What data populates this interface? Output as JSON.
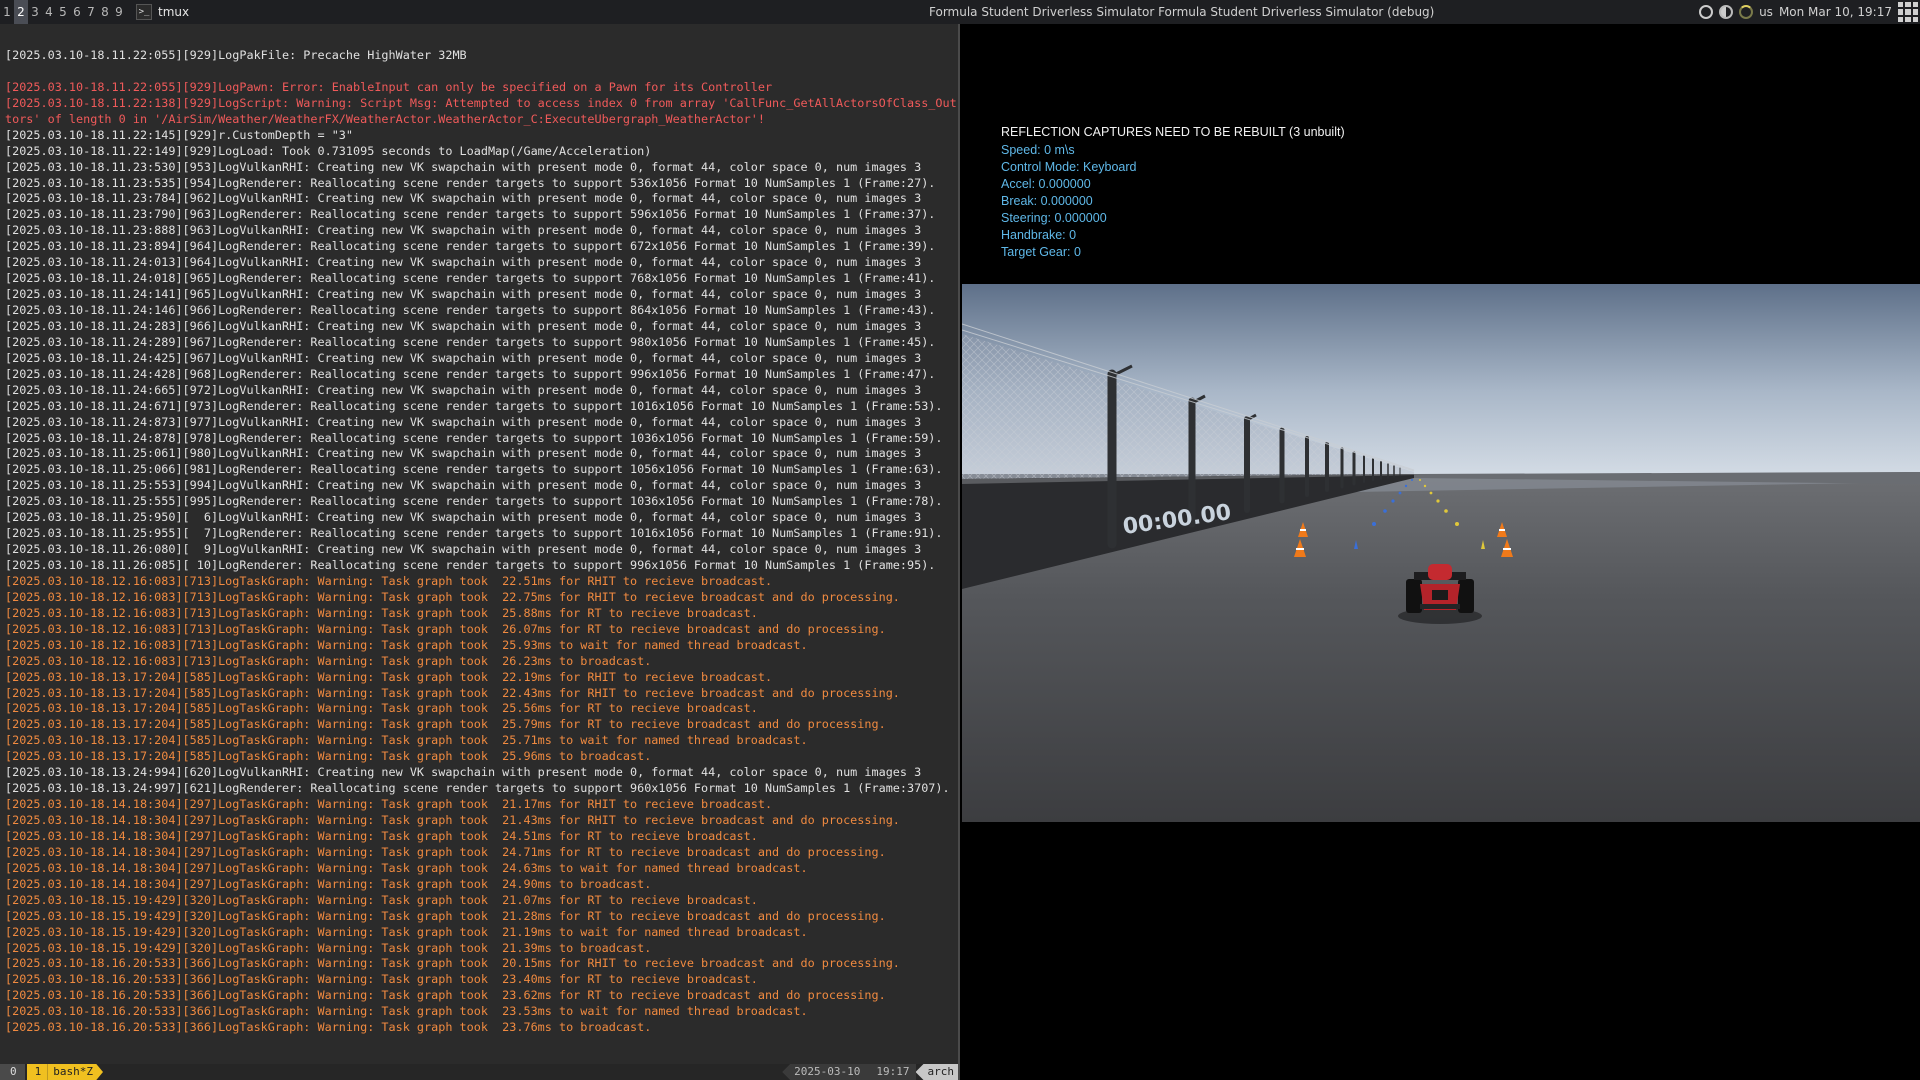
{
  "topbar": {
    "workspaces": [
      "1",
      "2",
      "3",
      "4",
      "5",
      "6",
      "7",
      "8",
      "9"
    ],
    "active_workspace": "2",
    "tmux_icon": ">_",
    "tmux_title": "tmux",
    "focused_title": "Formula Student Driverless Simulator Formula Student Driverless Simulator (debug)",
    "keyboard_layout": "us",
    "clock": "Mon Mar 10, 19:17"
  },
  "terminal": {
    "lines": [
      {
        "t": "[2025.03.10-18.11.22:055][929]LogPakFile: Precache HighWater 32MB",
        "k": "n"
      },
      {
        "t": "",
        "k": "blank"
      },
      {
        "t": "[2025.03.10-18.11.22:055][929]LogPawn: Error: EnableInput can only be specified on a Pawn for its Controller",
        "k": "err"
      },
      {
        "t": "[2025.03.10-18.11.22:138][929]LogScript: Warning: Script Msg: Attempted to access index 0 from array 'CallFunc_GetAllActorsOfClass_OutAc",
        "k": "err"
      },
      {
        "t": "tors' of length 0 in '/AirSim/Weather/WeatherFX/WeatherActor.WeatherActor_C:ExecuteUbergraph_WeatherActor'!",
        "k": "err"
      },
      {
        "t": "[2025.03.10-18.11.22:145][929]r.CustomDepth = \"3\"",
        "k": "n"
      },
      {
        "t": "[2025.03.10-18.11.22:149][929]LogLoad: Took 0.731095 seconds to LoadMap(/Game/Acceleration)",
        "k": "n"
      },
      {
        "t": "[2025.03.10-18.11.23:530][953]LogVulkanRHI: Creating new VK swapchain with present mode 0, format 44, color space 0, num images 3",
        "k": "n"
      },
      {
        "t": "[2025.03.10-18.11.23:535][954]LogRenderer: Reallocating scene render targets to support 536x1056 Format 10 NumSamples 1 (Frame:27).",
        "k": "n"
      },
      {
        "t": "[2025.03.10-18.11.23:784][962]LogVulkanRHI: Creating new VK swapchain with present mode 0, format 44, color space 0, num images 3",
        "k": "n"
      },
      {
        "t": "[2025.03.10-18.11.23:790][963]LogRenderer: Reallocating scene render targets to support 596x1056 Format 10 NumSamples 1 (Frame:37).",
        "k": "n"
      },
      {
        "t": "[2025.03.10-18.11.23:888][963]LogVulkanRHI: Creating new VK swapchain with present mode 0, format 44, color space 0, num images 3",
        "k": "n"
      },
      {
        "t": "[2025.03.10-18.11.23:894][964]LogRenderer: Reallocating scene render targets to support 672x1056 Format 10 NumSamples 1 (Frame:39).",
        "k": "n"
      },
      {
        "t": "[2025.03.10-18.11.24:013][964]LogVulkanRHI: Creating new VK swapchain with present mode 0, format 44, color space 0, num images 3",
        "k": "n"
      },
      {
        "t": "[2025.03.10-18.11.24:018][965]LogRenderer: Reallocating scene render targets to support 768x1056 Format 10 NumSamples 1 (Frame:41).",
        "k": "n"
      },
      {
        "t": "[2025.03.10-18.11.24:141][965]LogVulkanRHI: Creating new VK swapchain with present mode 0, format 44, color space 0, num images 3",
        "k": "n"
      },
      {
        "t": "[2025.03.10-18.11.24:146][966]LogRenderer: Reallocating scene render targets to support 864x1056 Format 10 NumSamples 1 (Frame:43).",
        "k": "n"
      },
      {
        "t": "[2025.03.10-18.11.24:283][966]LogVulkanRHI: Creating new VK swapchain with present mode 0, format 44, color space 0, num images 3",
        "k": "n"
      },
      {
        "t": "[2025.03.10-18.11.24:289][967]LogRenderer: Reallocating scene render targets to support 980x1056 Format 10 NumSamples 1 (Frame:45).",
        "k": "n"
      },
      {
        "t": "[2025.03.10-18.11.24:425][967]LogVulkanRHI: Creating new VK swapchain with present mode 0, format 44, color space 0, num images 3",
        "k": "n"
      },
      {
        "t": "[2025.03.10-18.11.24:428][968]LogRenderer: Reallocating scene render targets to support 996x1056 Format 10 NumSamples 1 (Frame:47).",
        "k": "n"
      },
      {
        "t": "[2025.03.10-18.11.24:665][972]LogVulkanRHI: Creating new VK swapchain with present mode 0, format 44, color space 0, num images 3",
        "k": "n"
      },
      {
        "t": "[2025.03.10-18.11.24:671][973]LogRenderer: Reallocating scene render targets to support 1016x1056 Format 10 NumSamples 1 (Frame:53).",
        "k": "n"
      },
      {
        "t": "[2025.03.10-18.11.24:873][977]LogVulkanRHI: Creating new VK swapchain with present mode 0, format 44, color space 0, num images 3",
        "k": "n"
      },
      {
        "t": "[2025.03.10-18.11.24:878][978]LogRenderer: Reallocating scene render targets to support 1036x1056 Format 10 NumSamples 1 (Frame:59).",
        "k": "n"
      },
      {
        "t": "[2025.03.10-18.11.25:061][980]LogVulkanRHI: Creating new VK swapchain with present mode 0, format 44, color space 0, num images 3",
        "k": "n"
      },
      {
        "t": "[2025.03.10-18.11.25:066][981]LogRenderer: Reallocating scene render targets to support 1056x1056 Format 10 NumSamples 1 (Frame:63).",
        "k": "n"
      },
      {
        "t": "[2025.03.10-18.11.25:553][994]LogVulkanRHI: Creating new VK swapchain with present mode 0, format 44, color space 0, num images 3",
        "k": "n"
      },
      {
        "t": "[2025.03.10-18.11.25:555][995]LogRenderer: Reallocating scene render targets to support 1036x1056 Format 10 NumSamples 1 (Frame:78).",
        "k": "n"
      },
      {
        "t": "[2025.03.10-18.11.25:950][  6]LogVulkanRHI: Creating new VK swapchain with present mode 0, format 44, color space 0, num images 3",
        "k": "n"
      },
      {
        "t": "[2025.03.10-18.11.25:955][  7]LogRenderer: Reallocating scene render targets to support 1016x1056 Format 10 NumSamples 1 (Frame:91).",
        "k": "n"
      },
      {
        "t": "[2025.03.10-18.11.26:080][  9]LogVulkanRHI: Creating new VK swapchain with present mode 0, format 44, color space 0, num images 3",
        "k": "n"
      },
      {
        "t": "[2025.03.10-18.11.26:085][ 10]LogRenderer: Reallocating scene render targets to support 996x1056 Format 10 NumSamples 1 (Frame:95).",
        "k": "n"
      },
      {
        "t": "[2025.03.10-18.12.16:083][713]LogTaskGraph: Warning: Task graph took  22.51ms for RHIT to recieve broadcast.",
        "k": "warn"
      },
      {
        "t": "[2025.03.10-18.12.16:083][713]LogTaskGraph: Warning: Task graph took  22.75ms for RHIT to recieve broadcast and do processing.",
        "k": "warn"
      },
      {
        "t": "[2025.03.10-18.12.16:083][713]LogTaskGraph: Warning: Task graph took  25.88ms for RT to recieve broadcast.",
        "k": "warn"
      },
      {
        "t": "[2025.03.10-18.12.16:083][713]LogTaskGraph: Warning: Task graph took  26.07ms for RT to recieve broadcast and do processing.",
        "k": "warn"
      },
      {
        "t": "[2025.03.10-18.12.16:083][713]LogTaskGraph: Warning: Task graph took  25.93ms to wait for named thread broadcast.",
        "k": "warn"
      },
      {
        "t": "[2025.03.10-18.12.16:083][713]LogTaskGraph: Warning: Task graph took  26.23ms to broadcast.",
        "k": "warn"
      },
      {
        "t": "[2025.03.10-18.13.17:204][585]LogTaskGraph: Warning: Task graph took  22.19ms for RHIT to recieve broadcast.",
        "k": "warn"
      },
      {
        "t": "[2025.03.10-18.13.17:204][585]LogTaskGraph: Warning: Task graph took  22.43ms for RHIT to recieve broadcast and do processing.",
        "k": "warn"
      },
      {
        "t": "[2025.03.10-18.13.17:204][585]LogTaskGraph: Warning: Task graph took  25.56ms for RT to recieve broadcast.",
        "k": "warn"
      },
      {
        "t": "[2025.03.10-18.13.17:204][585]LogTaskGraph: Warning: Task graph took  25.79ms for RT to recieve broadcast and do processing.",
        "k": "warn"
      },
      {
        "t": "[2025.03.10-18.13.17:204][585]LogTaskGraph: Warning: Task graph took  25.71ms to wait for named thread broadcast.",
        "k": "warn"
      },
      {
        "t": "[2025.03.10-18.13.17:204][585]LogTaskGraph: Warning: Task graph took  25.96ms to broadcast.",
        "k": "warn"
      },
      {
        "t": "[2025.03.10-18.13.24:994][620]LogVulkanRHI: Creating new VK swapchain with present mode 0, format 44, color space 0, num images 3",
        "k": "n"
      },
      {
        "t": "[2025.03.10-18.13.24:997][621]LogRenderer: Reallocating scene render targets to support 960x1056 Format 10 NumSamples 1 (Frame:3707).",
        "k": "n"
      },
      {
        "t": "[2025.03.10-18.14.18:304][297]LogTaskGraph: Warning: Task graph took  21.17ms for RHIT to recieve broadcast.",
        "k": "warn"
      },
      {
        "t": "[2025.03.10-18.14.18:304][297]LogTaskGraph: Warning: Task graph took  21.43ms for RHIT to recieve broadcast and do processing.",
        "k": "warn"
      },
      {
        "t": "[2025.03.10-18.14.18:304][297]LogTaskGraph: Warning: Task graph took  24.51ms for RT to recieve broadcast.",
        "k": "warn"
      },
      {
        "t": "[2025.03.10-18.14.18:304][297]LogTaskGraph: Warning: Task graph took  24.71ms for RT to recieve broadcast and do processing.",
        "k": "warn"
      },
      {
        "t": "[2025.03.10-18.14.18:304][297]LogTaskGraph: Warning: Task graph took  24.63ms to wait for named thread broadcast.",
        "k": "warn"
      },
      {
        "t": "[2025.03.10-18.14.18:304][297]LogTaskGraph: Warning: Task graph took  24.90ms to broadcast.",
        "k": "warn"
      },
      {
        "t": "[2025.03.10-18.15.19:429][320]LogTaskGraph: Warning: Task graph took  21.07ms for RT to recieve broadcast.",
        "k": "warn"
      },
      {
        "t": "[2025.03.10-18.15.19:429][320]LogTaskGraph: Warning: Task graph took  21.28ms for RT to recieve broadcast and do processing.",
        "k": "warn"
      },
      {
        "t": "[2025.03.10-18.15.19:429][320]LogTaskGraph: Warning: Task graph took  21.19ms to wait for named thread broadcast.",
        "k": "warn"
      },
      {
        "t": "[2025.03.10-18.15.19:429][320]LogTaskGraph: Warning: Task graph took  21.39ms to broadcast.",
        "k": "warn"
      },
      {
        "t": "[2025.03.10-18.16.20:533][366]LogTaskGraph: Warning: Task graph took  20.15ms for RHIT to recieve broadcast and do processing.",
        "k": "warn"
      },
      {
        "t": "[2025.03.10-18.16.20:533][366]LogTaskGraph: Warning: Task graph took  23.40ms for RT to recieve broadcast.",
        "k": "warn"
      },
      {
        "t": "[2025.03.10-18.16.20:533][366]LogTaskGraph: Warning: Task graph took  23.62ms for RT to recieve broadcast and do processing.",
        "k": "warn"
      },
      {
        "t": "[2025.03.10-18.16.20:533][366]LogTaskGraph: Warning: Task graph took  23.53ms to wait for named thread broadcast.",
        "k": "warn"
      },
      {
        "t": "[2025.03.10-18.16.20:533][366]LogTaskGraph: Warning: Task graph took  23.76ms to broadcast.",
        "k": "warn"
      }
    ],
    "status": {
      "session": "0",
      "window_index": "1",
      "window_name": "bash*Z",
      "date": "2025-03-10",
      "time": "19:17",
      "host": "arch"
    }
  },
  "game": {
    "reflection_warning": "REFLECTION CAPTURES NEED TO BE REBUILT (3 unbuilt)",
    "stats": [
      "Speed: 0 m\\s",
      "Control Mode: Keyboard",
      "Accel: 0.000000",
      "Break: 0.000000",
      "Steering: 0.000000",
      "Handbrake: 0",
      "Target Gear: 0"
    ],
    "wall_timer": "00:00.00"
  },
  "colors": {
    "error": "#f05a5a",
    "warning": "#f08a40",
    "stats_text": "#5fb8e8",
    "tmux_accent": "#f0c020"
  }
}
